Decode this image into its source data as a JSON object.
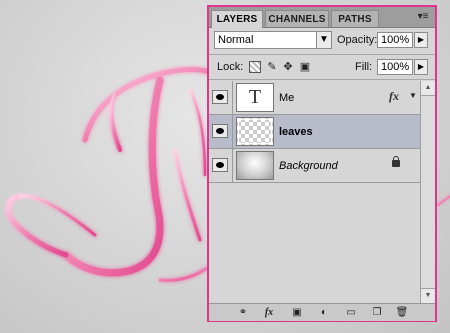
{
  "panel": {
    "tabs": [
      {
        "label": "LAYERS",
        "active": true
      },
      {
        "label": "CHANNELS",
        "active": false
      },
      {
        "label": "PATHS",
        "active": false
      }
    ],
    "menu_icon": "panel-menu-icon",
    "blend_mode": "Normal",
    "opacity_label": "Opacity:",
    "opacity_value": "100%",
    "lock_label": "Lock:",
    "fill_label": "Fill:",
    "fill_value": "100%",
    "lock_icons": [
      "lock-transparent-icon",
      "lock-image-icon",
      "lock-position-icon",
      "lock-all-icon"
    ],
    "layers": [
      {
        "name": "Me",
        "type": "text",
        "thumb_glyph": "T",
        "fx": "fx",
        "visible": true,
        "selected": false
      },
      {
        "name": "leaves",
        "type": "pixel",
        "visible": true,
        "selected": true
      },
      {
        "name": "Background",
        "type": "background",
        "visible": true,
        "selected": false,
        "locked": true
      }
    ],
    "bottom_icons": [
      "link-layers-icon",
      "add-style-icon",
      "add-mask-icon",
      "adjustment-layer-icon",
      "new-group-icon",
      "new-layer-icon",
      "delete-layer-icon"
    ],
    "fx_bottom": "fx"
  },
  "colors": {
    "accent_border": "#e0358f",
    "selected_row": "#b7bbca",
    "art_pink": "#f07fb0"
  }
}
